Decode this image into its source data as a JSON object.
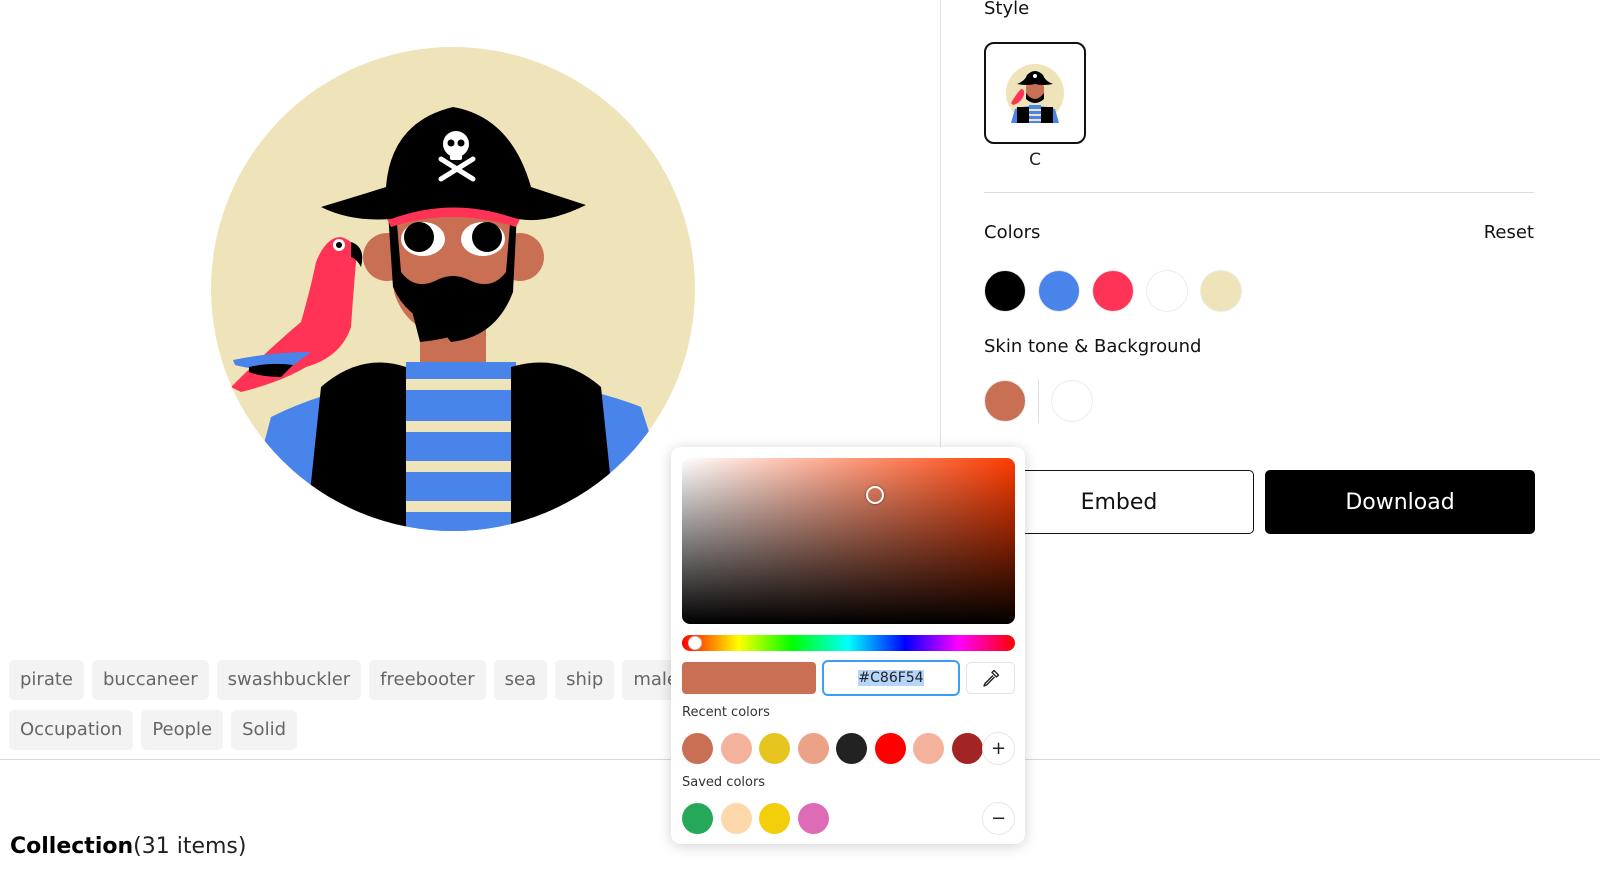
{
  "illustration": {
    "name": "pirate-avatar",
    "palette": {
      "outline": "#000000",
      "shirt_blue": "#4884EA",
      "accent_red": "#FF3355",
      "white": "#FFFFFF",
      "background": "#EFE4B9",
      "skin": "#C86F54"
    }
  },
  "tags": {
    "row1": [
      "pirate",
      "buccaneer",
      "swashbuckler",
      "freebooter",
      "sea",
      "ship",
      "male"
    ],
    "row2": [
      "Occupation",
      "People",
      "Solid"
    ]
  },
  "collection": {
    "title": "Collection",
    "count": "(31 items)"
  },
  "sidebar": {
    "style_title": "Style",
    "style_options": [
      {
        "label": "C",
        "selected": true
      }
    ],
    "colors_title": "Colors",
    "reset_label": "Reset",
    "colors": [
      "#000000",
      "#4884EA",
      "#FF3355",
      "#FFFFFF",
      "#EFE4B9"
    ],
    "skin_title": "Skin tone & Background",
    "skin_tone": "#C86F54",
    "background_color": "#FFFFFF",
    "embed_label": "Embed",
    "download_label": "Download"
  },
  "color_picker": {
    "hex_value": "#C86F54",
    "current_color": "#C86F54",
    "hue_degrees": 14,
    "saturation_percent": 58,
    "brightness_percent": 78,
    "recent_label": "Recent colors",
    "recent_colors": [
      "#C86F54",
      "#F4B29C",
      "#E6C520",
      "#EBA287",
      "#222222",
      "#FF0000",
      "#F4B29C",
      "#A32424"
    ],
    "add_label": "+",
    "saved_label": "Saved colors",
    "saved_colors": [
      "#26A85A",
      "#FDD8AA",
      "#F2CE0B",
      "#DD6BB6"
    ],
    "remove_label": "−"
  }
}
